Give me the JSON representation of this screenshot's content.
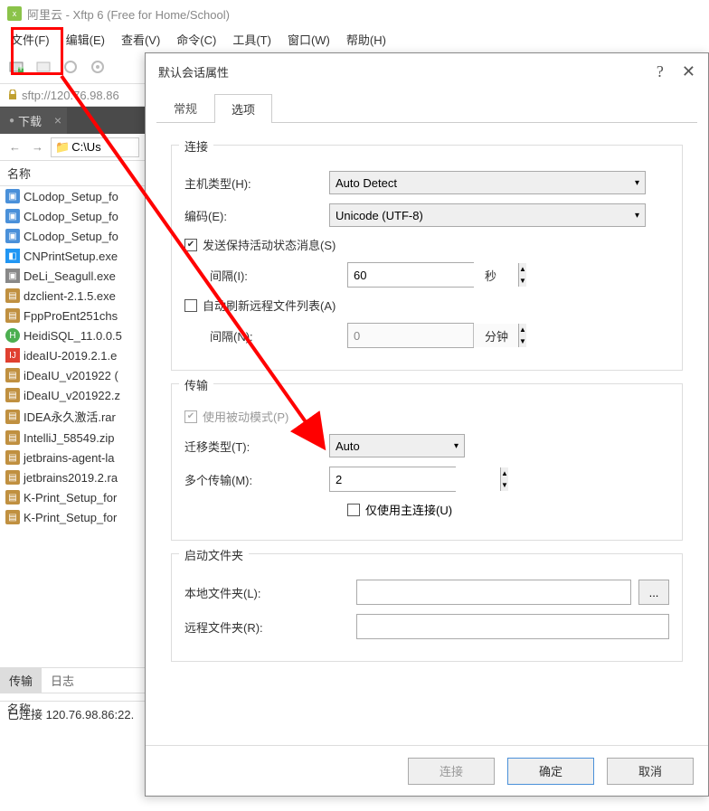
{
  "app": {
    "title": "阿里云 - Xftp 6 (Free for Home/School)"
  },
  "menu": [
    "文件(F)",
    "编辑(E)",
    "查看(V)",
    "命令(C)",
    "工具(T)",
    "窗口(W)",
    "帮助(H)"
  ],
  "address": "sftp://120.76.98.86",
  "left": {
    "tab": "下载",
    "path": "C:\\Us",
    "name_col": "名称",
    "files": [
      {
        "icon": "exe",
        "name": "CLodop_Setup_fo"
      },
      {
        "icon": "exe",
        "name": "CLodop_Setup_fo"
      },
      {
        "icon": "exe",
        "name": "CLodop_Setup_fo"
      },
      {
        "icon": "exe-blue",
        "name": "CNPrintSetup.exe"
      },
      {
        "icon": "exe-gray",
        "name": "DeLi_Seagull.exe"
      },
      {
        "icon": "zip",
        "name": "dzclient-2.1.5.exe"
      },
      {
        "icon": "zip",
        "name": "FppProEnt251chs"
      },
      {
        "icon": "exe-green",
        "name": "HeidiSQL_11.0.0.5"
      },
      {
        "icon": "exe-red",
        "name": "ideaIU-2019.2.1.e"
      },
      {
        "icon": "zip",
        "name": "iDeaIU_v201922 ("
      },
      {
        "icon": "zip",
        "name": "iDeaIU_v201922.z"
      },
      {
        "icon": "zip",
        "name": "IDEA永久激活.rar"
      },
      {
        "icon": "zip",
        "name": "IntelliJ_58549.zip"
      },
      {
        "icon": "zip",
        "name": "jetbrains-agent-la"
      },
      {
        "icon": "zip",
        "name": "jetbrains2019.2.ra"
      },
      {
        "icon": "zip",
        "name": "K-Print_Setup_for"
      },
      {
        "icon": "zip",
        "name": "K-Print_Setup_for"
      }
    ],
    "bottom_tabs": {
      "transfer": "传输",
      "log": "日志"
    },
    "bottom_name": "名称"
  },
  "status": "已连接 120.76.98.86:22.",
  "dialog": {
    "title": "默认会话属性",
    "tabs": {
      "general": "常规",
      "options": "选项"
    },
    "connect_group": "连接",
    "host_type": "主机类型(H):",
    "host_type_val": "Auto Detect",
    "encoding": "编码(E):",
    "encoding_val": "Unicode (UTF-8)",
    "keepalive": "发送保持活动状态消息(S)",
    "interval1": "间隔(I):",
    "interval1_val": "60",
    "interval1_unit": "秒",
    "autorefresh": "自动刷新远程文件列表(A)",
    "interval2": "间隔(N):",
    "interval2_val": "0",
    "interval2_unit": "分钟",
    "transfer_group": "传输",
    "passive": "使用被动模式(P)",
    "transfer_type": "迁移类型(T):",
    "transfer_type_val": "Auto",
    "multi": "多个传输(M):",
    "multi_val": "2",
    "main_only": "仅使用主连接(U)",
    "startup_group": "启动文件夹",
    "local_folder": "本地文件夹(L):",
    "remote_folder": "远程文件夹(R):",
    "browse": "...",
    "btn_connect": "连接",
    "btn_ok": "确定",
    "btn_cancel": "取消"
  }
}
